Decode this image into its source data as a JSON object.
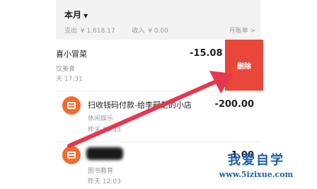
{
  "month_header": {
    "title": "本月",
    "expense_label": "支出",
    "expense_amount": "¥ 1,618.17",
    "income_label": "收入",
    "income_amount": "¥ 0.00",
    "monthly_bill_link": "月账单 >"
  },
  "swiped_item": {
    "name": "喜小冒菜",
    "amount": "-15.08",
    "category": "饮美食",
    "time": "天 17:31",
    "delete_label": "删除"
  },
  "transactions": [
    {
      "name": "扫收钱码付款-给李嗣芝的小店",
      "category": "休闲娱乐",
      "time": "昨天 13:33",
      "amount": "-200.00"
    },
    {
      "name": "",
      "category": "图书教育",
      "time": "昨天 12:03",
      "amount": "-1.00"
    }
  ],
  "watermark": {
    "title": "我爱自学",
    "url": "www.5izixue.com"
  },
  "colors": {
    "delete_red": "#e8473a",
    "arrow_red": "#e8364e",
    "icon_orange": "#f26b2d",
    "watermark_blue": "#1f5fad"
  }
}
